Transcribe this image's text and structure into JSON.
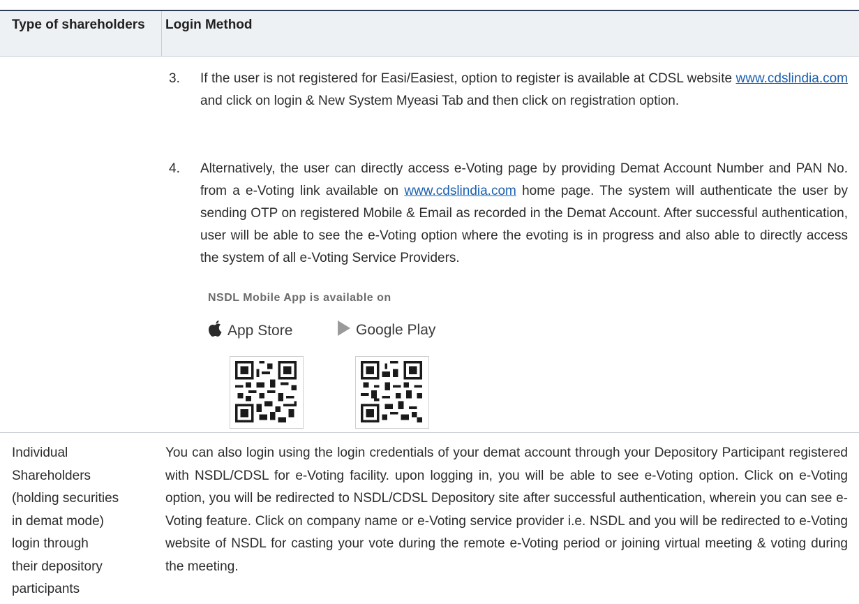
{
  "header": {
    "col1": "Type of shareholders",
    "col2": "Login Method"
  },
  "items": [
    {
      "number": "3.",
      "text_before": "If the user is not registered for Easi/Easiest, option to register is available at CDSL website ",
      "link": "www.cdslindia.com",
      "text_after": " and click on login & New System Myeasi Tab and then click on registration option."
    },
    {
      "number": "4.",
      "text_before": "Alternatively, the user can directly access e-Voting page by providing Demat Account Number and PAN No. from a e-Voting link available on ",
      "link": "www.cdslindia.com",
      "text_after": " home page. The system will authenticate the user by sending OTP on registered Mobile & Email as recorded in the Demat Account. After successful authentication, user will be able to see the e-Voting option where the evoting is in progress and also able to directly access the system of all e-Voting Service Providers."
    }
  ],
  "nsdl_app": {
    "label": "NSDL Mobile App is available on",
    "app_store": "App Store",
    "google_play": "Google Play",
    "app_store_icon": "apple-logo-icon",
    "google_play_icon": "play-triangle-icon"
  },
  "row2": {
    "type_lines": [
      "Individual",
      "Shareholders",
      "(holding securities",
      "in demat mode)",
      "login through",
      "their depository",
      "participants"
    ],
    "method": "You can also login using the login credentials of your demat account through your Depository Participant registered with NSDL/CDSL for e-Voting facility. upon logging in, you will be able to see e-Voting option. Click on e-Voting option, you will be redirected to NSDL/CDSL Depository site after successful authentication, wherein you can see e-Voting feature. Click on company name or e-Voting service provider i.e. NSDL and you will be redirected to e-Voting website of NSDL for casting your vote during the remote e-Voting period or joining virtual meeting & voting during the meeting."
  },
  "colors": {
    "header_bg": "#eef1f4",
    "top_rule": "#2b3a55",
    "link": "#1a5fb0"
  }
}
